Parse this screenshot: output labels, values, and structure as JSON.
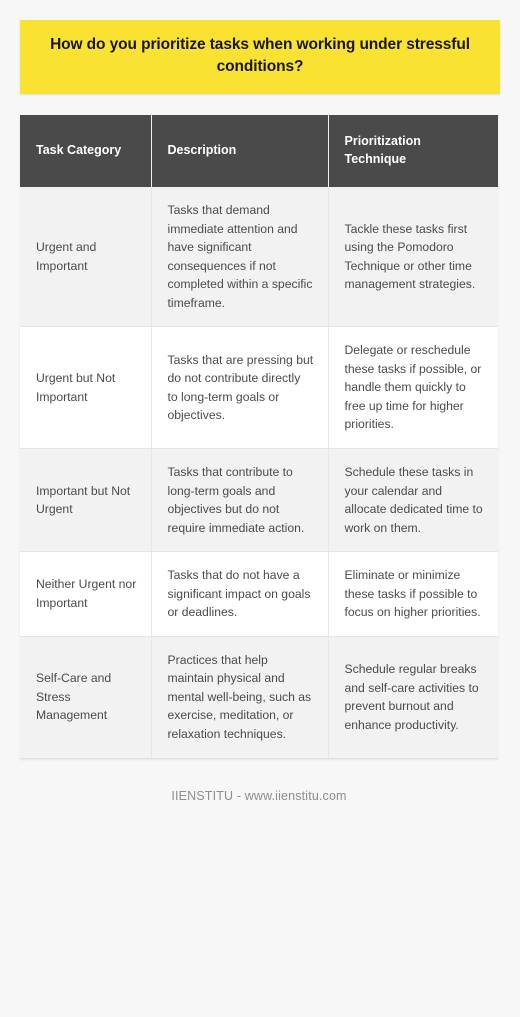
{
  "banner": {
    "question": "How do you prioritize tasks when working under stressful conditions?",
    "background_color": "#fae233",
    "text_color": "#161616"
  },
  "table": {
    "header_background": "#4a4a4a",
    "header_text_color": "#ffffff",
    "stripe_color": "#f2f2f2",
    "columns": [
      {
        "label": "Task Category"
      },
      {
        "label": "Description"
      },
      {
        "label": "Prioritization Technique"
      }
    ],
    "rows": [
      {
        "category": "Urgent and Important",
        "description": "Tasks that demand immediate attention and have significant consequences if not completed within a specific timeframe.",
        "technique": "Tackle these tasks first using the Pomodoro Technique or other time management strategies."
      },
      {
        "category": "Urgent but Not Important",
        "description": "Tasks that are pressing but do not contribute directly to long-term goals or objectives.",
        "technique": "Delegate or reschedule these tasks if possible, or handle them quickly to free up time for higher priorities."
      },
      {
        "category": "Important but Not Urgent",
        "description": "Tasks that contribute to long-term goals and objectives but do not require immediate action.",
        "technique": "Schedule these tasks in your calendar and allocate dedicated time to work on them."
      },
      {
        "category": "Neither Urgent nor Important",
        "description": "Tasks that do not have a significant impact on goals or deadlines.",
        "technique": "Eliminate or minimize these tasks if possible to focus on higher priorities."
      },
      {
        "category": "Self-Care and Stress Management",
        "description": "Practices that help maintain physical and mental well-being, such as exercise, meditation, or relaxation techniques.",
        "technique": "Schedule regular breaks and self-care activities to prevent burnout and enhance productivity."
      }
    ]
  },
  "footer": {
    "credit": "IIENSTITU - www.iienstitu.com"
  }
}
